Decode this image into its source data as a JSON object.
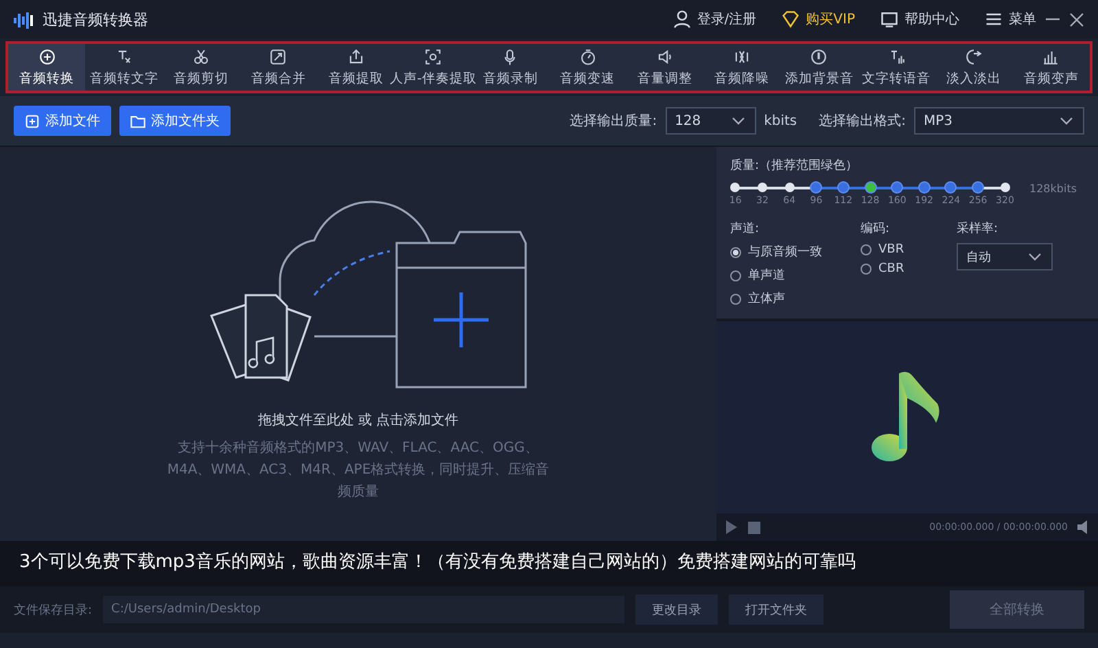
{
  "window": {
    "title": "迅捷音频转换器"
  },
  "header_actions": [
    {
      "kind": "user",
      "label": "登录/注册"
    },
    {
      "kind": "vip",
      "label": "购买VIP"
    },
    {
      "kind": "help",
      "label": "帮助中心"
    },
    {
      "kind": "menu",
      "label": "菜单"
    }
  ],
  "toolbar": [
    {
      "label": "音频转换",
      "selected": true
    },
    {
      "label": "音频转文字",
      "selected": false
    },
    {
      "label": "音频剪切",
      "selected": false
    },
    {
      "label": "音频合并",
      "selected": false
    },
    {
      "label": "音频提取",
      "selected": false
    },
    {
      "label": "人声-伴奏提取",
      "selected": false
    },
    {
      "label": "音频录制",
      "selected": false
    },
    {
      "label": "音频变速",
      "selected": false
    },
    {
      "label": "音量调整",
      "selected": false
    },
    {
      "label": "音频降噪",
      "selected": false
    },
    {
      "label": "添加背景音",
      "selected": false
    },
    {
      "label": "文字转语音",
      "selected": false
    },
    {
      "label": "淡入淡出",
      "selected": false
    },
    {
      "label": "音频变声",
      "selected": false
    }
  ],
  "actions": {
    "add_file": "添加文件",
    "add_folder": "添加文件夹",
    "quality_label": "选择输出质量:",
    "quality_value": "128",
    "quality_unit": "kbits",
    "format_label": "选择输出格式:",
    "format_value": "MP3"
  },
  "drop_zone": {
    "hint": "拖拽文件至此处 或 点击添加文件",
    "formats": "支持十余种音频格式的MP3、WAV、FLAC、AAC、OGG、M4A、WMA、AC3、M4R、APE格式转换，同时提升、压缩音频质量"
  },
  "settings": {
    "quality_title": "质量:（推荐范围绿色）",
    "quality_reading": "128kbits",
    "ticks": [
      {
        "label": "16",
        "recommended": false,
        "selected": false
      },
      {
        "label": "32",
        "recommended": false,
        "selected": false
      },
      {
        "label": "64",
        "recommended": false,
        "selected": false
      },
      {
        "label": "96",
        "recommended": true,
        "selected": false
      },
      {
        "label": "112",
        "recommended": true,
        "selected": false
      },
      {
        "label": "128",
        "recommended": true,
        "selected": true
      },
      {
        "label": "160",
        "recommended": true,
        "selected": false
      },
      {
        "label": "192",
        "recommended": true,
        "selected": false
      },
      {
        "label": "224",
        "recommended": true,
        "selected": false
      },
      {
        "label": "256",
        "recommended": true,
        "selected": false
      },
      {
        "label": "320",
        "recommended": false,
        "selected": false
      }
    ],
    "channel_title": "声道:",
    "channels": [
      {
        "label": "与原音频一致",
        "selected": true
      },
      {
        "label": "单声道",
        "selected": false
      },
      {
        "label": "立体声",
        "selected": false
      }
    ],
    "encoding_title": "编码:",
    "encodings": [
      {
        "label": "VBR",
        "selected": false
      },
      {
        "label": "CBR",
        "selected": false
      }
    ],
    "sample_rate_title": "采样率:",
    "sample_rate": "自动"
  },
  "preview": {
    "time": "00:00:00.000 / 00:00:00.000"
  },
  "caption": "3个可以免费下载mp3音乐的网站，歌曲资源丰富！（有没有免费搭建自己网站的）免费搭建网站的可靠吗",
  "bottom_bar": {
    "save_label": "文件保存目录:",
    "save_path": "C:/Users/admin/Desktop",
    "change_dir": "更改目录",
    "open_folder": "打开文件夹",
    "convert_all": "全部转换"
  }
}
